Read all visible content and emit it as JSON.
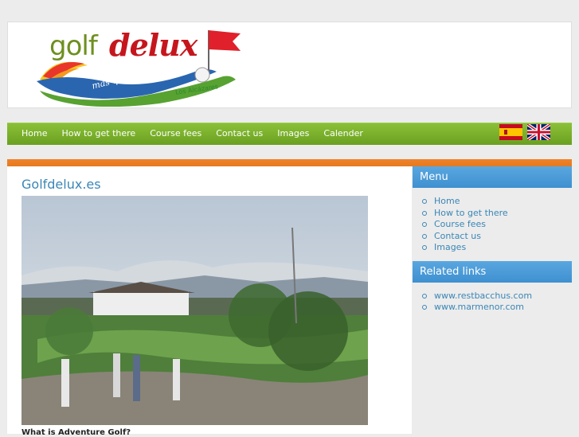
{
  "logo": {
    "word1": "golf",
    "word2": "delux",
    "slogan": "más que minigolf",
    "place": "Los Alcázares"
  },
  "nav": {
    "items": [
      "Home",
      "How to get there",
      "Course fees",
      "Contact us",
      "Images",
      "Calender"
    ],
    "flags": [
      "spanish-flag-icon",
      "english-flag-icon"
    ]
  },
  "main": {
    "title": "Golfdelux.es",
    "subtitle": "What is Adventure Golf?"
  },
  "sidebar": {
    "menu_title": "Menu",
    "menu_items": [
      "Home",
      "How to get there",
      "Course fees",
      "Contact us",
      "Images"
    ],
    "links_title": "Related links",
    "links": [
      "www.restbacchus.com",
      "www.marmenor.com"
    ]
  },
  "colors": {
    "nav_green": "#7ab32c",
    "accent_orange": "#f0822a",
    "sidebar_blue": "#4a9ad8",
    "link_blue": "#3a86b6"
  }
}
